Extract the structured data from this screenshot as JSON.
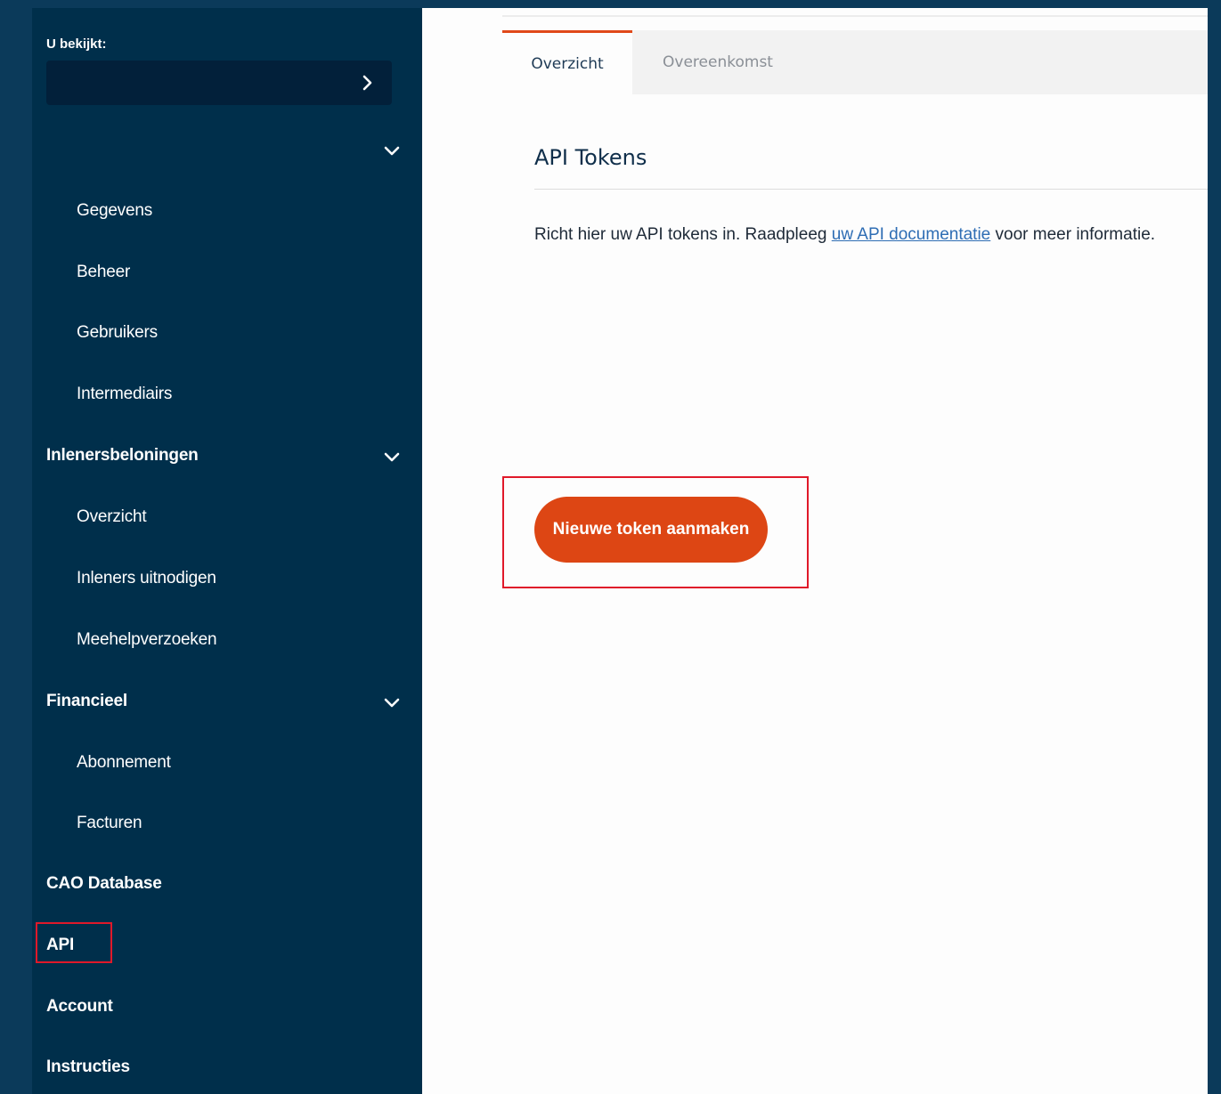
{
  "sidebar": {
    "viewing_label": "U bekijkt:",
    "viewing_value": "",
    "items": [
      {
        "label": "Gegevens",
        "level": "sub"
      },
      {
        "label": "Beheer",
        "level": "sub"
      },
      {
        "label": "Gebruikers",
        "level": "sub"
      },
      {
        "label": "Intermediairs",
        "level": "sub"
      },
      {
        "label": "Inlenersbeloningen",
        "level": "top",
        "expandable": true
      },
      {
        "label": "Overzicht",
        "level": "sub"
      },
      {
        "label": "Inleners uitnodigen",
        "level": "sub"
      },
      {
        "label": "Meehelpverzoeken",
        "level": "sub"
      },
      {
        "label": "Financieel",
        "level": "top",
        "expandable": true
      },
      {
        "label": "Abonnement",
        "level": "sub"
      },
      {
        "label": "Facturen",
        "level": "sub"
      },
      {
        "label": "CAO Database",
        "level": "top"
      },
      {
        "label": "API",
        "level": "top",
        "highlighted": true
      },
      {
        "label": "Account",
        "level": "top"
      },
      {
        "label": "Instructies",
        "level": "top"
      }
    ]
  },
  "main": {
    "tabs": [
      {
        "label": "Overzicht",
        "active": true
      },
      {
        "label": "Overeenkomst",
        "active": false
      }
    ],
    "section_title": "API Tokens",
    "intro_before": "Richt hier uw API tokens in. Raadpleeg ",
    "intro_link": "uw API documentatie",
    "intro_after": " voor meer informatie.",
    "create_button": "Nieuwe token aanmaken"
  },
  "colors": {
    "sidebar_bg": "#002f4b",
    "accent": "#dd4614",
    "highlight_box": "#e0192a",
    "link": "#2e6db4"
  }
}
